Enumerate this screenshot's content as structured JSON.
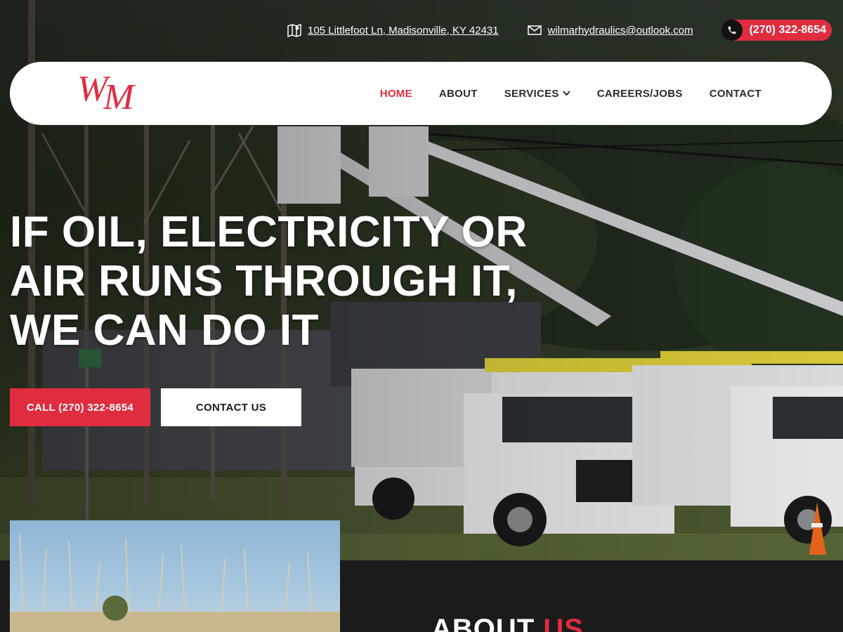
{
  "topbar": {
    "address": "105 Littlefoot Ln, Madisonville, KY 42431",
    "email": "wilmarhydraulics@outlook.com",
    "phone": "(270) 322-8654",
    "icons": {
      "address": "map-icon",
      "email": "mail-icon",
      "phone": "phone-icon"
    }
  },
  "header": {
    "logo_w": "W",
    "logo_m": "M",
    "nav": [
      {
        "label": "HOME",
        "active": true
      },
      {
        "label": "ABOUT"
      },
      {
        "label": "SERVICES",
        "dropdown": true
      },
      {
        "label": "CAREERS/JOBS"
      },
      {
        "label": "CONTACT"
      }
    ]
  },
  "hero": {
    "headline_lines": [
      "IF OIL, ELECTRICITY OR",
      "AIR RUNS THROUGH IT,",
      "WE CAN DO IT"
    ],
    "call_button": "CALL (270) 322-8654",
    "contact_button": "CONTACT US"
  },
  "about": {
    "title_main": "ABOUT",
    "title_accent": "US"
  },
  "colors": {
    "accent": "#e02c3f",
    "dark": "#1b1b1b",
    "white": "#ffffff"
  }
}
